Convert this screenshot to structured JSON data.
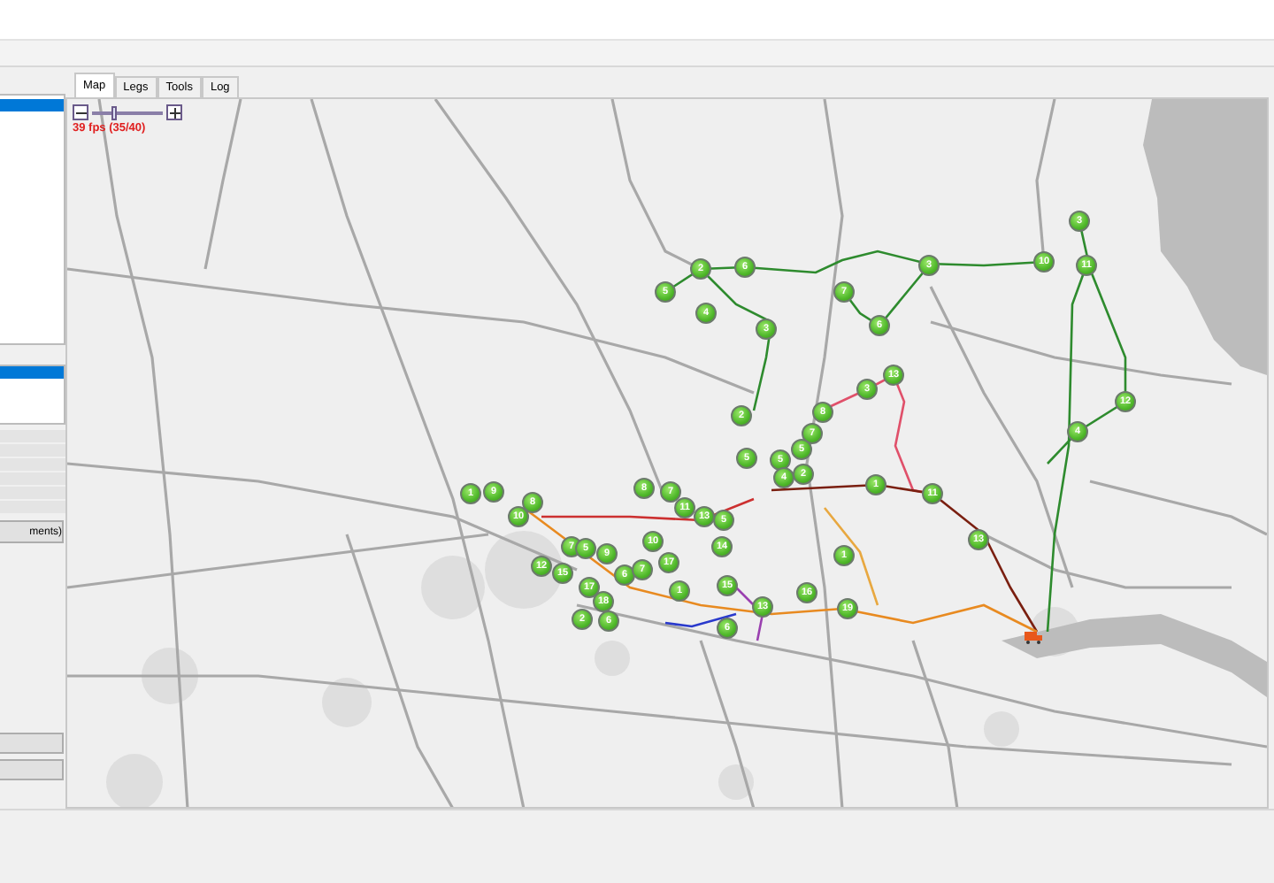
{
  "tabs": [
    {
      "label": "Map",
      "selected": true
    },
    {
      "label": "Legs",
      "selected": false
    },
    {
      "label": "Tools",
      "selected": false
    },
    {
      "label": "Log",
      "selected": false
    }
  ],
  "left_panel": {
    "list_1": {
      "rows": [
        {
          "selected": true
        }
      ]
    },
    "list_2": {
      "rows": [
        {
          "selected": true
        }
      ]
    },
    "button": "ments)"
  },
  "map": {
    "zoom_slider": {
      "level": 0.32
    },
    "fps": "39 fps (35/40)",
    "markers": [
      {
        "label": "3"
      },
      {
        "label": "2"
      },
      {
        "label": "6"
      },
      {
        "label": "3"
      },
      {
        "label": "10"
      },
      {
        "label": "11"
      },
      {
        "label": "5"
      },
      {
        "label": "7"
      },
      {
        "label": "4"
      },
      {
        "label": "3"
      },
      {
        "label": "6"
      },
      {
        "label": "13"
      },
      {
        "label": "3"
      },
      {
        "label": "12"
      },
      {
        "label": "2"
      },
      {
        "label": "8"
      },
      {
        "label": "7"
      },
      {
        "label": "4"
      },
      {
        "label": "5"
      },
      {
        "label": "5"
      },
      {
        "label": "5"
      },
      {
        "label": "4"
      },
      {
        "label": "2"
      },
      {
        "label": "1"
      },
      {
        "label": "9"
      },
      {
        "label": "8"
      },
      {
        "label": "7"
      },
      {
        "label": "1"
      },
      {
        "label": "11"
      },
      {
        "label": "8"
      },
      {
        "label": "11"
      },
      {
        "label": "10"
      },
      {
        "label": "13"
      },
      {
        "label": "5"
      },
      {
        "label": "7"
      },
      {
        "label": "5"
      },
      {
        "label": "10"
      },
      {
        "label": "14"
      },
      {
        "label": "13"
      },
      {
        "label": "9"
      },
      {
        "label": "1"
      },
      {
        "label": "12"
      },
      {
        "label": "15"
      },
      {
        "label": "6"
      },
      {
        "label": "7"
      },
      {
        "label": "17"
      },
      {
        "label": "17"
      },
      {
        "label": "1"
      },
      {
        "label": "15"
      },
      {
        "label": "16"
      },
      {
        "label": "18"
      },
      {
        "label": "13"
      },
      {
        "label": "19"
      },
      {
        "label": "2"
      },
      {
        "label": "6"
      },
      {
        "label": "6"
      }
    ]
  }
}
